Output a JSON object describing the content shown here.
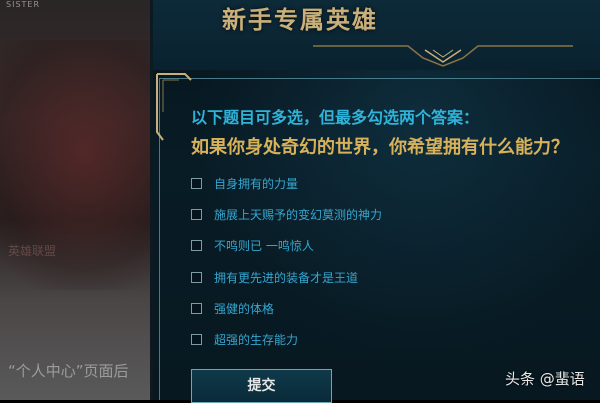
{
  "left_panel": {
    "top_caption": "SISTER",
    "mid_caption": "英雄联盟",
    "bottom_text": "“个人中心”页面后"
  },
  "header": {
    "title": "新手专属英雄"
  },
  "question": {
    "hint": "以下题目可多选，但最多勾选两个答案：",
    "title": "如果你身处奇幻的世界，你希望拥有什么能力？"
  },
  "options": [
    {
      "label": "自身拥有的力量",
      "checked": false
    },
    {
      "label": "施展上天赐予的变幻莫测的神力",
      "checked": false
    },
    {
      "label": "不鸣则已 一鸣惊人",
      "checked": false
    },
    {
      "label": "拥有更先进的装备才是王道",
      "checked": false
    },
    {
      "label": "强健的体格",
      "checked": false
    },
    {
      "label": "超强的生存能力",
      "checked": false
    }
  ],
  "submit": {
    "label": "提交"
  },
  "watermark": {
    "text": "头条 @蜚语"
  },
  "colors": {
    "gold": "#d8b25a",
    "cyan": "#2fb3d8",
    "option_text": "#36a6cf",
    "background": "#081c26"
  }
}
